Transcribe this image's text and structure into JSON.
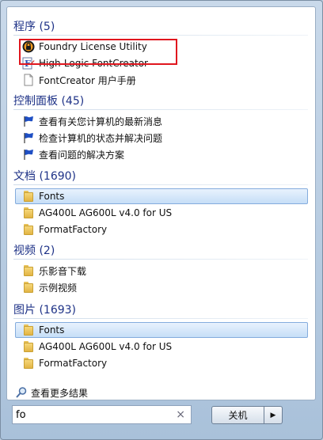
{
  "groups": [
    {
      "title": "程序 (5)",
      "items": [
        {
          "label": "Foundry License Utility",
          "icon": "foundry-app-icon"
        },
        {
          "label": "High-Logic FontCreator",
          "icon": "fontcreator-app-icon"
        },
        {
          "label": "FontCreator 用户手册",
          "icon": "document-icon"
        }
      ]
    },
    {
      "title": "控制面板 (45)",
      "items": [
        {
          "label": "查看有关您计算机的最新消息",
          "icon": "flag-icon"
        },
        {
          "label": "检查计算机的状态并解决问题",
          "icon": "flag-icon"
        },
        {
          "label": "查看问题的解决方案",
          "icon": "flag-icon"
        }
      ]
    },
    {
      "title": "文档 (1690)",
      "items": [
        {
          "label": "Fonts",
          "icon": "folder-icon"
        },
        {
          "label": "AG400L AG600L v4.0 for US",
          "icon": "folder-icon"
        },
        {
          "label": "FormatFactory",
          "icon": "folder-icon"
        }
      ]
    },
    {
      "title": "视频 (2)",
      "items": [
        {
          "label": "乐影音下载",
          "icon": "folder-icon"
        },
        {
          "label": "示例视频",
          "icon": "folder-icon"
        }
      ]
    },
    {
      "title": "图片 (1693)",
      "items": [
        {
          "label": "Fonts",
          "icon": "folder-icon"
        },
        {
          "label": "AG400L AG600L v4.0 for US",
          "icon": "folder-icon"
        },
        {
          "label": "FormatFactory",
          "icon": "folder-icon"
        }
      ]
    }
  ],
  "see_more": "查看更多结果",
  "search": {
    "value": "fo",
    "clear": "×"
  },
  "shutdown": {
    "label": "关机",
    "arrow": "▶"
  },
  "colors": {
    "header": "#1e3287",
    "highlight_box": "#e0161e",
    "selection": "#c6def7"
  }
}
